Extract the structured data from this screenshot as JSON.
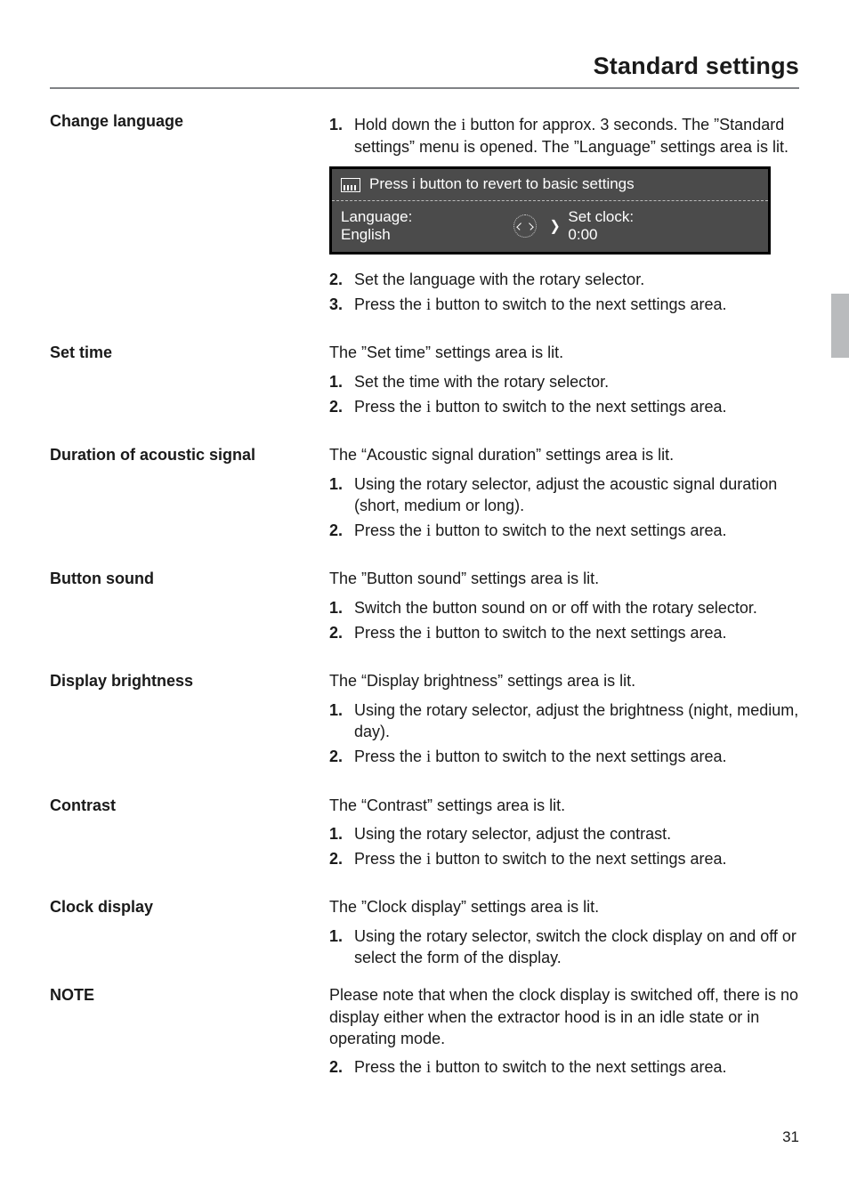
{
  "title": "Standard settings",
  "page_number": "31",
  "lcd": {
    "top_text": "Press i button to revert to basic settings",
    "language_label": "Language:",
    "language_value": "English",
    "clock_label": "Set clock:",
    "clock_value": "0:00"
  },
  "sections": {
    "change_language": {
      "heading": "Change language",
      "step1a": "Hold down the ",
      "step1b": " button for approx. 3 seconds. The ”Standard settings” menu is opened. The ”Language” settings area is lit.",
      "step2": "Set the language with the rotary selector.",
      "step3a": "Press the ",
      "step3b": " button to switch to the next settings area."
    },
    "set_time": {
      "heading": "Set time",
      "intro": "The ”Set time” settings area is lit.",
      "step1": "Set the time with the rotary selector.",
      "step2a": "Press the ",
      "step2b": " button to switch to the next settings area."
    },
    "acoustic": {
      "heading": "Duration of acoustic signal",
      "intro": "The “Acoustic signal duration” settings area is lit.",
      "step1": "Using the rotary selector, adjust the acoustic signal duration (short, medium or long).",
      "step2a": "Press the ",
      "step2b": " button to switch to the next settings area."
    },
    "button_sound": {
      "heading": "Button sound",
      "intro": "The ”Button sound” settings area is lit.",
      "step1": "Switch the button sound on or off with the rotary selector.",
      "step2a": "Press the ",
      "step2b": " button to switch to the next settings area."
    },
    "display_brightness": {
      "heading": "Display brightness",
      "intro": "The “Display brightness” settings area is lit.",
      "step1": "Using the rotary selector, adjust the brightness (night, medium, day).",
      "step2a": "Press the ",
      "step2b": " button to switch to the next settings area."
    },
    "contrast": {
      "heading": "Contrast",
      "intro": "The “Contrast” settings area is lit.",
      "step1": "Using the rotary selector, adjust the contrast.",
      "step2a": "Press the ",
      "step2b": " button to switch to the next settings area."
    },
    "clock_display": {
      "heading": "Clock display",
      "intro": "The ”Clock display” settings area is lit.",
      "step1": "Using the rotary selector, switch the clock display on and off or select the form of the display."
    },
    "note": {
      "heading": "NOTE",
      "text": "Please note that when the clock display is switched off, there is no display either when the extractor hood is in an idle state or in operating mode.",
      "step2a": "Press the ",
      "step2b": " button to switch to the next settings area."
    }
  },
  "num": {
    "1": "1.",
    "2": "2.",
    "3": "3."
  },
  "glyph": {
    "i": "i",
    "arrow": "❯"
  }
}
